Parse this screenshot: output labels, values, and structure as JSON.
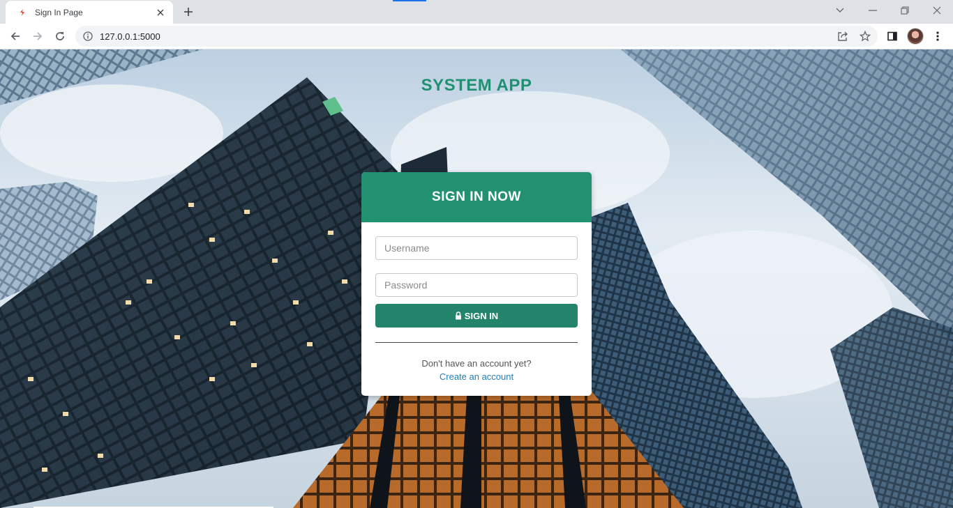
{
  "browser": {
    "tab_title": "Sign In Page",
    "url": "127.0.0.1:5000",
    "icons": [
      "favicon-icon",
      "close-icon",
      "plus-icon",
      "back-icon",
      "forward-icon",
      "reload-icon",
      "info-icon",
      "share-icon",
      "star-icon",
      "sidepanel-icon",
      "avatar",
      "menu-icon",
      "chevron-down-icon",
      "minimize-icon",
      "restore-icon",
      "window-close-icon"
    ]
  },
  "page": {
    "app_title": "SYSTEM APP",
    "card": {
      "header": "SIGN IN NOW",
      "username_placeholder": "Username",
      "password_placeholder": "Password",
      "signin_label": "SIGN IN",
      "no_account_text": "Don't have an account yet?",
      "create_account_label": "Create an account"
    }
  },
  "colors": {
    "accent": "#229172",
    "title": "#1f9171",
    "button": "#22846a",
    "link": "#1e7fb8"
  }
}
